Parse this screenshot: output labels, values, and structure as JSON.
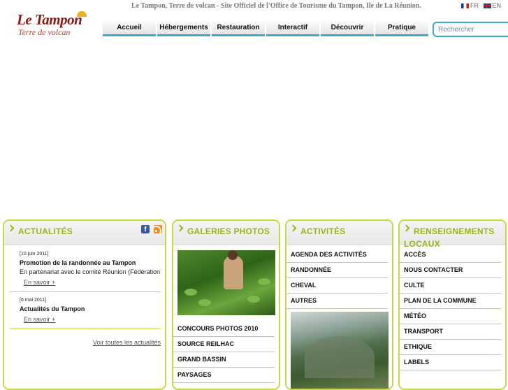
{
  "header": {
    "logo_title": "Le Tampon",
    "logo_subtitle": "Terre de volcan",
    "tagline": "Le Tampon, Terre de volcan - Site Officiel de l'Office de Tourisme du Tampon, Ile de La Réunion.",
    "languages": [
      {
        "code": "FR",
        "flag": "flag-fr"
      },
      {
        "code": "EN",
        "flag": "flag-gb"
      }
    ]
  },
  "nav": {
    "items": [
      "Accueil",
      "Hébergements",
      "Restauration",
      "Interactif",
      "Découvrir",
      "Pratique"
    ]
  },
  "search": {
    "placeholder": "Rechercher"
  },
  "colors": {
    "accent_green": "#9bb31a",
    "panel_border": "#c8d64a",
    "nav_accent": "#3fa9c8"
  },
  "actualites": {
    "title": "ACTUALITÉS",
    "news": [
      {
        "date": "[10 juin 2011]",
        "title": "Promotion de la randonnée au Tampon",
        "excerpt": "En partenariat avec le comité Réunion (Fédération",
        "more": "En savoir +"
      },
      {
        "date": "[6 mai 2011]",
        "title": "Actualités du Tampon",
        "more": "En savoir +"
      }
    ],
    "all_link": "Voir toutes les actualités"
  },
  "galeries": {
    "title": "GALERIES PHOTOS",
    "items": [
      "CONCOURS PHOTOS 2010",
      "SOURCE REILHAC",
      "GRAND BASSIN",
      "PAYSAGES"
    ]
  },
  "activites": {
    "title": "ACTIVITÉS",
    "items": [
      "AGENDA DES ACTIVITÉS",
      "RANDONNÉE",
      "CHEVAL",
      "AUTRES"
    ]
  },
  "renseignements": {
    "title": "RENSEIGNEMENTS LOCAUX",
    "items": [
      "ACCÈS",
      "NOUS CONTACTER",
      "CULTE",
      "PLAN DE LA COMMUNE",
      "MÉTÉO",
      "TRANSPORT",
      "ETHIQUE",
      "LABELS"
    ]
  }
}
